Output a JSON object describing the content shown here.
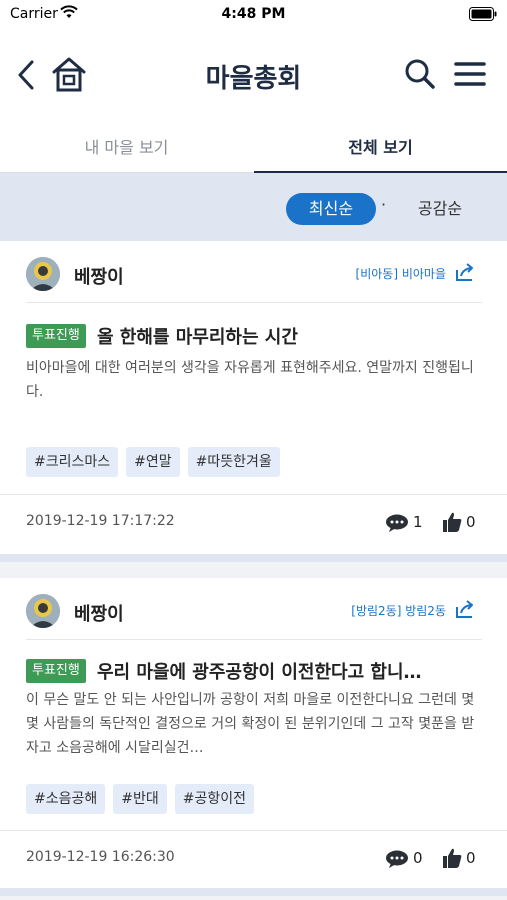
{
  "status_bar": {
    "carrier": "Carrier",
    "time": "4:48 PM"
  },
  "header": {
    "title": "마을총회"
  },
  "tabs": [
    {
      "label": "내 마을 보기"
    },
    {
      "label": "전체 보기"
    }
  ],
  "sort": {
    "newest_label": "최신순",
    "separator": "·",
    "likes_label": "공감순"
  },
  "posts": [
    {
      "author": "베짱이",
      "village": "[비아동] 비아마을",
      "status_badge": "투표진행",
      "title": "올 한해를 마무리하는 시간",
      "body": "비아마을에 대한 여러분의 생각을 자유롭게 표현해주세요. 연말까지 진행됩니다.",
      "hashtags": [
        "#크리스마스",
        "#연말",
        "#따뜻한겨울"
      ],
      "date": "2019-12-19 17:17:22",
      "comments": "1",
      "likes": "0"
    },
    {
      "author": "베짱이",
      "village": "[방림2동] 방림2동",
      "status_badge": "투표진행",
      "title": "우리 마을에 광주공항이 이전한다고 합니…",
      "body": "이 무슨 말도 안 되는 사안입니까 공항이 저희 마을로 이전한다니요 그런데 몇몇 사람들의 독단적인 결정으로 거의 확정이 된 분위기인데 그 고작 몇푼을 받자고 소음공해에 시달리실건…",
      "hashtags": [
        "#소음공해",
        "#반대",
        "#공항이전"
      ],
      "date": "2019-12-19 16:26:30",
      "comments": "0",
      "likes": "0"
    }
  ],
  "colors": {
    "accent": "#1a73c8",
    "title": "#1e2d44",
    "badge": "#3e9b56",
    "tag_bg": "#e3ecf8",
    "sort_bar_bg": "#dfe6f1"
  },
  "icons": [
    "wifi-icon",
    "battery-icon",
    "back-chevron-icon",
    "home-icon",
    "search-icon",
    "menu-icon",
    "share-icon",
    "comment-icon",
    "thumbs-up-icon"
  ]
}
